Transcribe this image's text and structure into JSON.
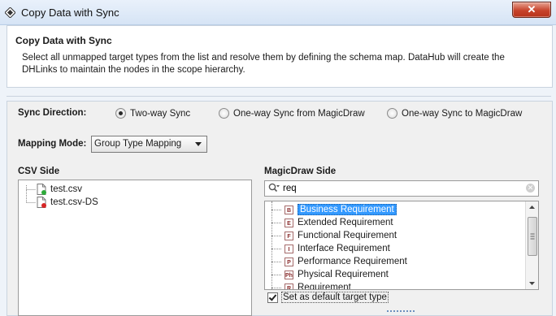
{
  "window": {
    "title": "Copy Data with Sync",
    "close_label": "✕"
  },
  "header": {
    "title": "Copy Data with Sync",
    "description": "Select all unmapped target types from the list and resolve them by defining the schema map. DataHub will create the DHLinks to maintain the nodes in the scope hierarchy."
  },
  "sync": {
    "label": "Sync Direction:",
    "options": [
      "Two-way Sync",
      "One-way Sync from MagicDraw",
      "One-way Sync to MagicDraw"
    ],
    "selected": "Two-way Sync"
  },
  "mapping": {
    "label": "Mapping Mode:",
    "value": "Group Type Mapping"
  },
  "csv_side": {
    "label": "CSV Side",
    "items": [
      "test.csv",
      "test.csv-DS"
    ]
  },
  "magicdraw_side": {
    "label": "MagicDraw Side",
    "search_value": "req",
    "items": [
      {
        "icon": "B",
        "label": "Business Requirement"
      },
      {
        "icon": "E",
        "label": "Extended Requirement"
      },
      {
        "icon": "F",
        "label": "Functional Requirement"
      },
      {
        "icon": "I",
        "label": "Interface Requirement"
      },
      {
        "icon": "P",
        "label": "Performance Requirement"
      },
      {
        "icon": "Ph",
        "label": "Physical Requirement"
      },
      {
        "icon": "R",
        "label": "Requirement"
      }
    ],
    "selected_index": 0
  },
  "default_target": {
    "label": "Set as default target type",
    "checked": true
  },
  "colors": {
    "selection": "#3399ff",
    "close_button": "#c7432b"
  }
}
